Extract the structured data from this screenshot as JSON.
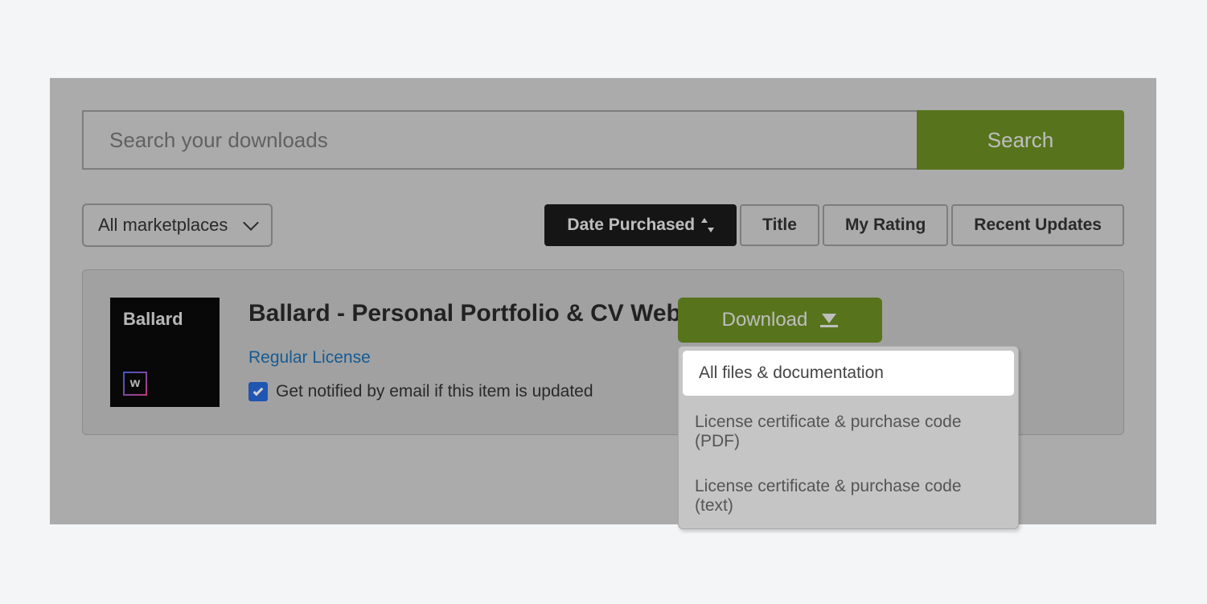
{
  "search": {
    "placeholder": "Search your downloads",
    "button_label": "Search"
  },
  "marketplace_filter": {
    "selected": "All marketplaces"
  },
  "sort": {
    "date_purchased": "Date Purchased",
    "title": "Title",
    "my_rating": "My Rating",
    "recent_updates": "Recent Updates"
  },
  "item": {
    "thumb_title": "Ballard",
    "thumb_w": "w",
    "title": "Ballard - Personal Portfolio & CV Webflow Theme",
    "license": "Regular License",
    "notify_label": "Get notified by email if this item is updated"
  },
  "download": {
    "button_label": "Download",
    "options": {
      "all_files": "All files & documentation",
      "license_pdf": "License certificate & purchase code (PDF)",
      "license_text": "License certificate & purchase code (text)"
    }
  }
}
